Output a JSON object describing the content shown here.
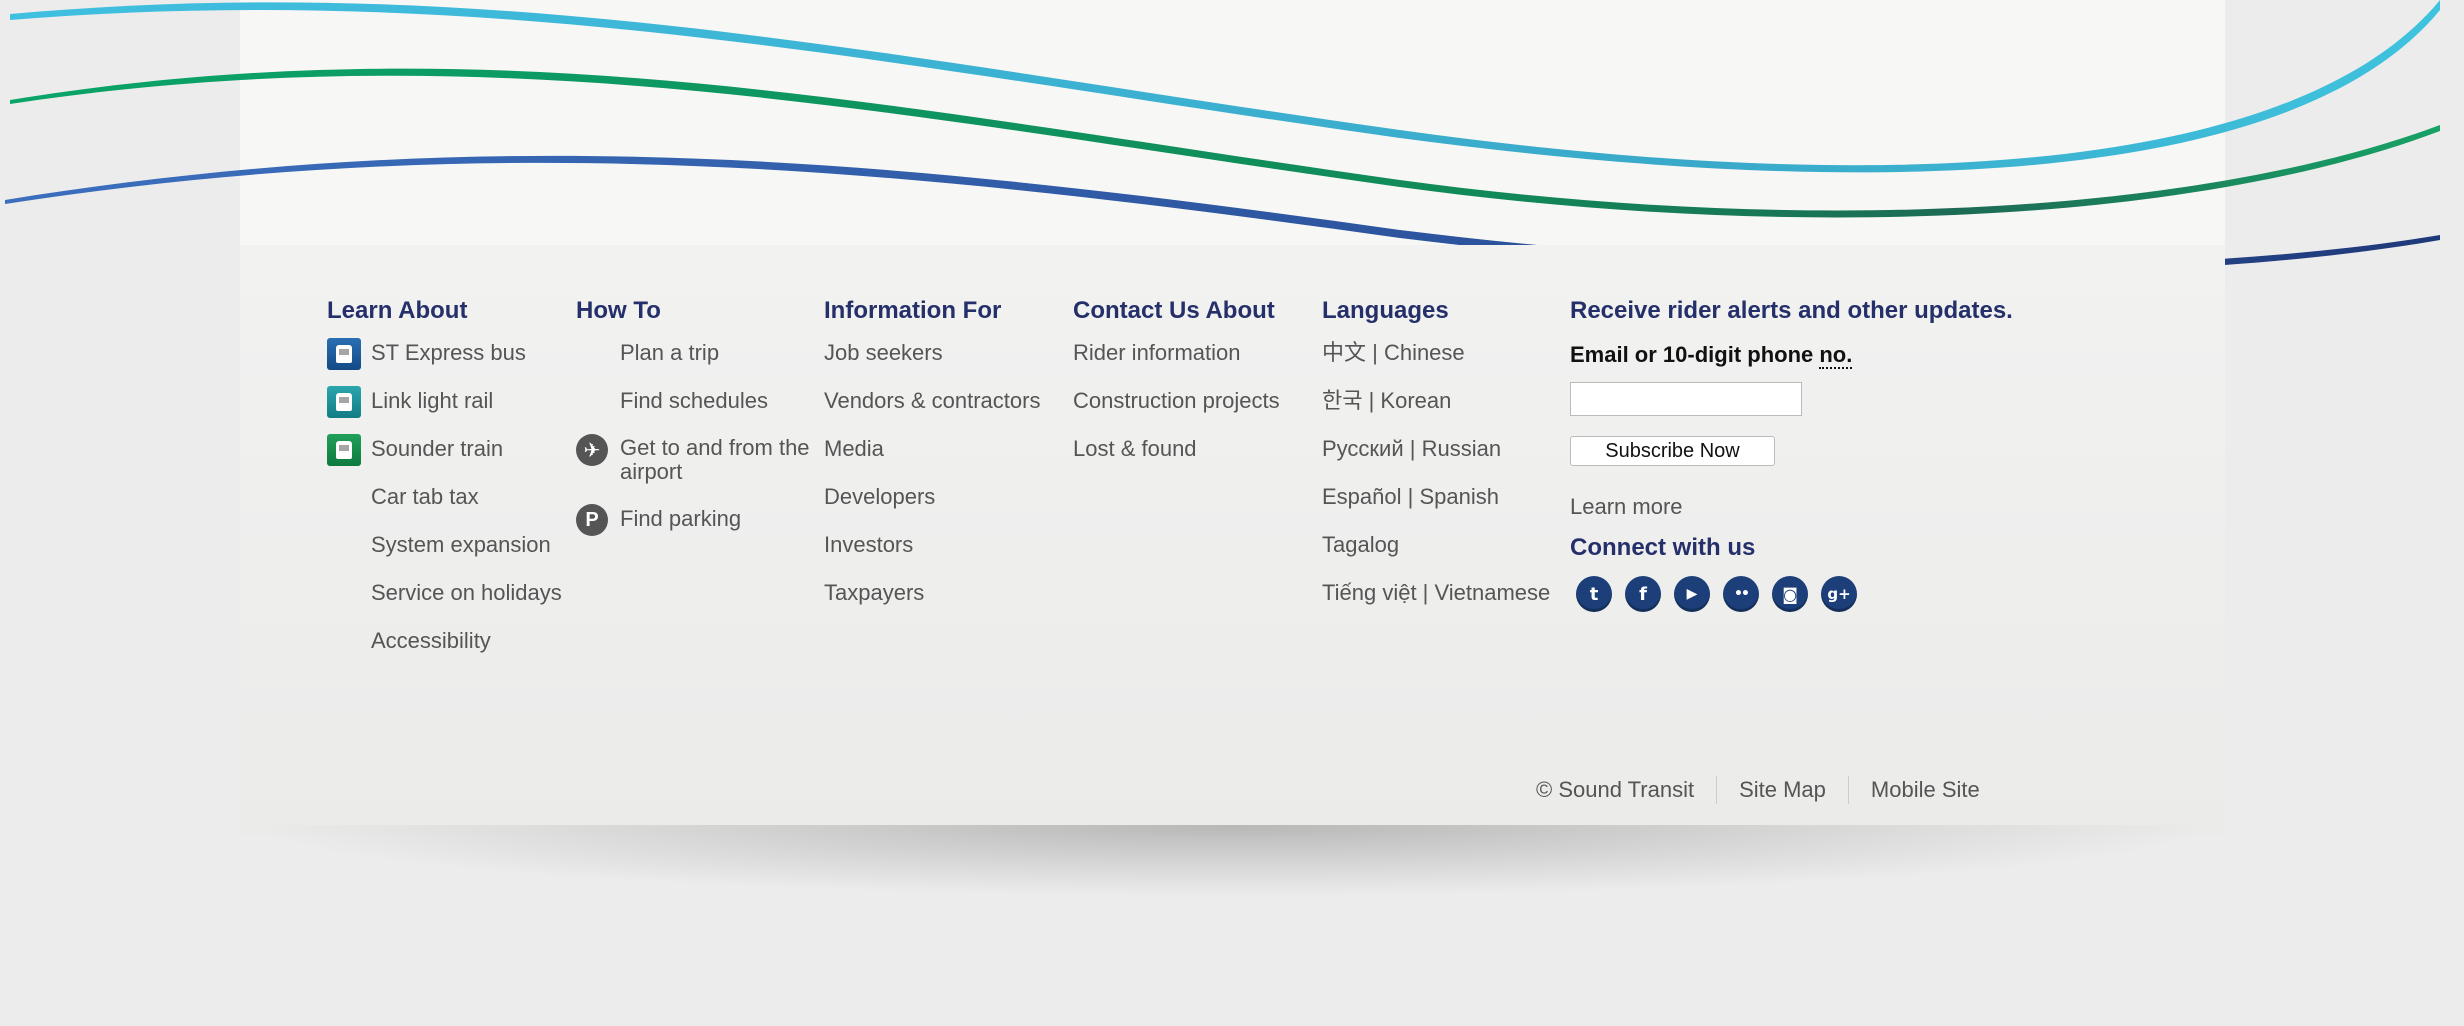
{
  "learn_about": {
    "heading": "Learn About",
    "items": [
      {
        "label": "ST Express bus",
        "icon": "bus-icon"
      },
      {
        "label": "Link light rail",
        "icon": "light-rail-icon"
      },
      {
        "label": "Sounder train",
        "icon": "train-icon"
      },
      {
        "label": "Car tab tax"
      },
      {
        "label": "System expansion"
      },
      {
        "label": "Service on holidays"
      },
      {
        "label": "Accessibility"
      }
    ]
  },
  "how_to": {
    "heading": "How To",
    "items": [
      {
        "label": "Plan a trip"
      },
      {
        "label": "Find schedules"
      },
      {
        "label": "Get to and from the airport",
        "icon": "airplane-icon"
      },
      {
        "label": "Find parking",
        "icon": "parking-icon"
      }
    ]
  },
  "information_for": {
    "heading": "Information For",
    "items": [
      "Job seekers",
      "Vendors & contractors",
      "Media",
      "Developers",
      "Investors",
      "Taxpayers"
    ]
  },
  "contact_us": {
    "heading": "Contact Us About",
    "items": [
      "Rider information",
      "Construction projects",
      "Lost & found"
    ]
  },
  "languages": {
    "heading": "Languages",
    "items": [
      "中文 | Chinese",
      "한국 | Korean",
      "Русский | Russian",
      "Español | Spanish",
      "Tagalog",
      "Tiếng việt | Vietnamese"
    ]
  },
  "alerts": {
    "heading": "Receive rider alerts and other updates.",
    "label_prefix": "Email or 10-digit phone ",
    "label_abbr": "no.",
    "input_value": "",
    "subscribe_label": "Subscribe Now",
    "learn_more": "Learn more",
    "connect_heading": "Connect with us",
    "social": [
      {
        "name": "twitter",
        "glyph": "t"
      },
      {
        "name": "facebook",
        "glyph": "f"
      },
      {
        "name": "youtube",
        "glyph": "▶"
      },
      {
        "name": "flickr",
        "glyph": "••"
      },
      {
        "name": "instagram",
        "glyph": "◙"
      },
      {
        "name": "google-plus",
        "glyph": "g+"
      }
    ]
  },
  "bottom": {
    "copyright": "© Sound Transit",
    "site_map": "Site Map",
    "mobile_site": "Mobile Site"
  },
  "colors": {
    "heading": "#25306a",
    "wave_cyan": "#3ab7d8",
    "wave_green": "#0f9a63",
    "wave_blue": "#2e5fb0"
  }
}
